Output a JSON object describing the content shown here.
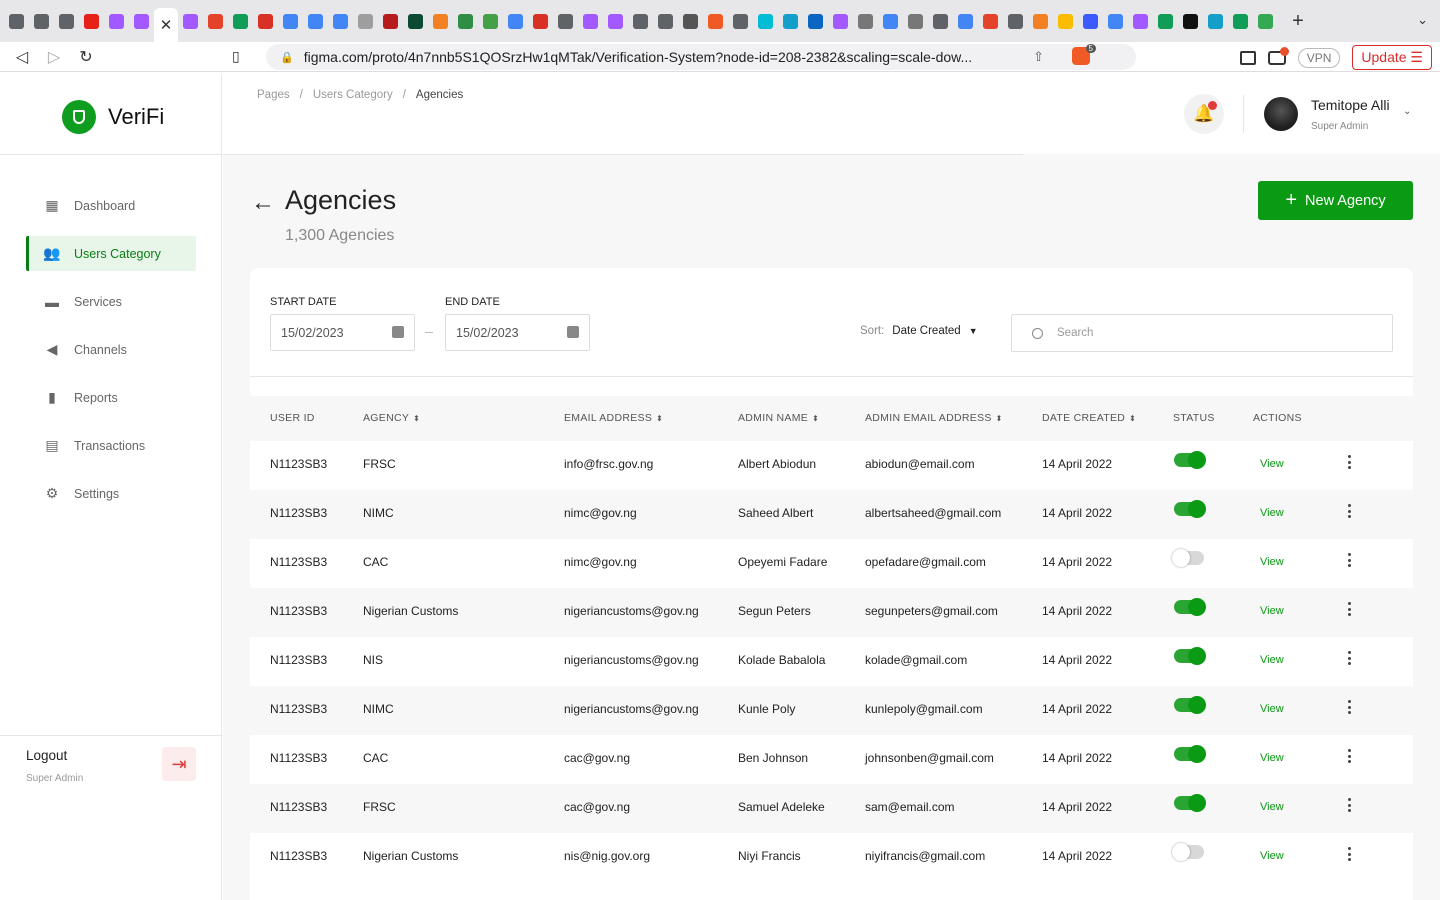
{
  "browser": {
    "url": "figma.com/proto/4n7nnb5S1QOSrzHw1qMTak/Verification-System?node-id=208-2382&scaling=scale-dow...",
    "vpn_label": "VPN",
    "update_label": "Update",
    "brave_badge": "5",
    "tab_favicon_colors": [
      "#5f6368",
      "#5f6368",
      "#5f6368",
      "#e62117",
      "#a259ff",
      "#a259ff",
      "#a259ff",
      "#e24329",
      "#0f9d58",
      "#d93025",
      "#4285f4",
      "#4285f4",
      "#4285f4",
      "#9e9e9e",
      "#b71c1c",
      "#0c4b33",
      "#f48024",
      "#2f8d46",
      "#43a047",
      "#4285f4",
      "#d93025",
      "#5f6368",
      "#a259ff",
      "#a259ff",
      "#5f6368",
      "#5f6368",
      "#555555",
      "#f05a24",
      "#5f6368",
      "#00bcd4",
      "#149eca",
      "#0a66c2",
      "#a259ff",
      "#777777",
      "#4285f4",
      "#777777",
      "#5f6368",
      "#4285f4",
      "#e24329",
      "#5f6368",
      "#f48024",
      "#fbbc04",
      "#3d5afe",
      "#4285f4",
      "#a259ff",
      "#0f9d58",
      "#111111",
      "#149eca",
      "#0f9d58",
      "#34a853"
    ]
  },
  "sidebar": {
    "brand": "VeriFi",
    "items": [
      {
        "label": "Dashboard",
        "icon": "dashboard-icon"
      },
      {
        "label": "Users Category",
        "icon": "users-icon"
      },
      {
        "label": "Services",
        "icon": "briefcase-icon"
      },
      {
        "label": "Channels",
        "icon": "megaphone-icon"
      },
      {
        "label": "Reports",
        "icon": "bar-chart-icon"
      },
      {
        "label": "Transactions",
        "icon": "document-icon"
      },
      {
        "label": "Settings",
        "icon": "gear-icon"
      }
    ],
    "logout_label": "Logout",
    "logout_role": "Super Admin"
  },
  "topbar": {
    "breadcrumb": [
      "Pages",
      "Users Category",
      "Agencies"
    ],
    "user_name": "Temitope Alli",
    "user_role": "Super Admin"
  },
  "page": {
    "title": "Agencies",
    "subtitle": "1,300 Agencies",
    "new_button": "New Agency"
  },
  "filters": {
    "start_label": "START DATE",
    "start_value": "15/02/2023",
    "end_label": "END DATE",
    "end_value": "15/02/2023",
    "sort_label": "Sort:",
    "sort_value": "Date Created",
    "search_placeholder": "Search"
  },
  "table": {
    "headers": [
      "USER ID",
      "AGENCY",
      "EMAIL ADDRESS",
      "ADMIN NAME",
      "ADMIN EMAIL ADDRESS",
      "DATE CREATED",
      "STATUS",
      "ACTIONS"
    ],
    "view_label": "View",
    "rows": [
      {
        "user_id": "N1123SB3",
        "agency": "FRSC",
        "email": "info@frsc.gov.ng",
        "admin_name": "Albert Abiodun",
        "admin_email": "abiodun@email.com",
        "date": "14 April 2022",
        "active": true
      },
      {
        "user_id": "N1123SB3",
        "agency": "NIMC",
        "email": "nimc@gov.ng",
        "admin_name": "Saheed Albert",
        "admin_email": "albertsaheed@gmail.com",
        "date": "14 April 2022",
        "active": true
      },
      {
        "user_id": "N1123SB3",
        "agency": "CAC",
        "email": "nimc@gov.ng",
        "admin_name": "Opeyemi Fadare",
        "admin_email": "opefadare@gmail.com",
        "date": "14 April 2022",
        "active": false
      },
      {
        "user_id": "N1123SB3",
        "agency": "Nigerian Customs",
        "email": "nigeriancustoms@gov.ng",
        "admin_name": "Segun Peters",
        "admin_email": "segunpeters@gmail.com",
        "date": "14 April 2022",
        "active": true
      },
      {
        "user_id": "N1123SB3",
        "agency": "NIS",
        "email": "nigeriancustoms@gov.ng",
        "admin_name": "Kolade Babalola",
        "admin_email": "kolade@gmail.com",
        "date": "14 April 2022",
        "active": true
      },
      {
        "user_id": "N1123SB3",
        "agency": "NIMC",
        "email": "nigeriancustoms@gov.ng",
        "admin_name": "Kunle Poly",
        "admin_email": "kunlepoly@gmail.com",
        "date": "14 April 2022",
        "active": true
      },
      {
        "user_id": "N1123SB3",
        "agency": "CAC",
        "email": "cac@gov.ng",
        "admin_name": "Ben Johnson",
        "admin_email": "johnsonben@gmail.com",
        "date": "14 April 2022",
        "active": true
      },
      {
        "user_id": "N1123SB3",
        "agency": "FRSC",
        "email": "cac@gov.ng",
        "admin_name": "Samuel Adeleke",
        "admin_email": "sam@email.com",
        "date": "14 April 2022",
        "active": true
      },
      {
        "user_id": "N1123SB3",
        "agency": "Nigerian Customs",
        "email": "nis@nig.gov.org",
        "admin_name": "Niyi Francis",
        "admin_email": "niyifrancis@gmail.com",
        "date": "14 April 2022",
        "active": false
      }
    ]
  }
}
